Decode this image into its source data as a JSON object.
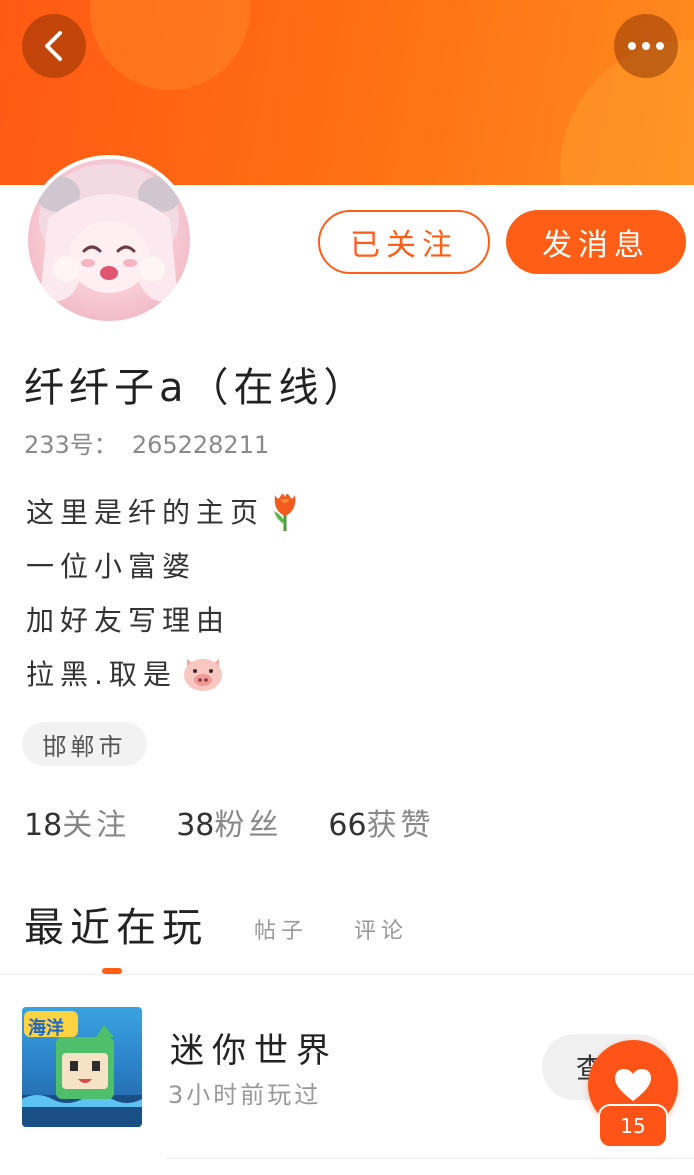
{
  "header": {
    "back_icon": "chevron-left-icon",
    "more_icon": "more-dots-icon",
    "gradient_colors": [
      "#ff5a14",
      "#ff8a1e"
    ]
  },
  "profile": {
    "avatar_alt": "avatar",
    "followed_label": "已关注",
    "message_label": "发消息",
    "name": "纤纤子a（在线）",
    "id_label": "233号：",
    "id_value": "265228211",
    "bio": [
      "这里是纤的主页",
      "一位小富婆",
      "加好友写理由",
      "拉黑.取是"
    ],
    "bio_emojis": [
      "tulip-icon",
      "pig-face-icon"
    ],
    "location": "邯郸市"
  },
  "stats": [
    {
      "num": "18",
      "label": "关注"
    },
    {
      "num": "38",
      "label": "粉丝"
    },
    {
      "num": "66",
      "label": "获赞"
    }
  ],
  "tabs": {
    "active": "最近在玩",
    "items": [
      "帖子",
      "评论"
    ]
  },
  "recent_game": {
    "thumb_label": "海洋",
    "name": "迷你世界",
    "time": "3小时前玩过",
    "view_label": "查"
  },
  "like": {
    "count": "15",
    "icon": "heart-icon"
  },
  "accent_color": "#ff5e17"
}
